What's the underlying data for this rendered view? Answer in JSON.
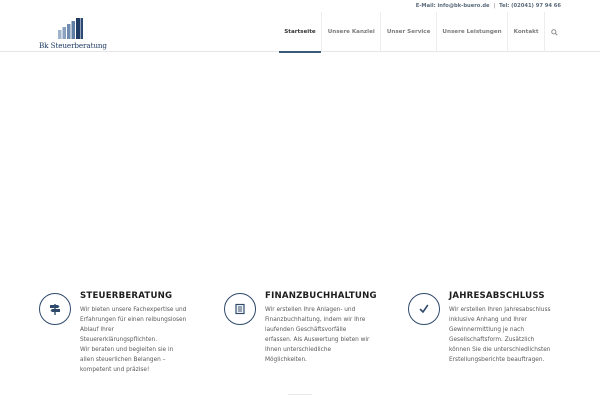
{
  "topbar": {
    "email": "E-Mail: info@bk-buero.de",
    "separator": "|",
    "phone": "Tel: (02041) 97 94 66"
  },
  "logo": {
    "text": "Bk Steuerberatung",
    "colors": {
      "light": "#9fb4cc",
      "mid": "#5f7ea3",
      "dark": "#1f3a63"
    }
  },
  "nav": {
    "items": [
      {
        "label": "Startseite",
        "active": true
      },
      {
        "label": "Unsere Kanzlei",
        "active": false
      },
      {
        "label": "Unser Service",
        "active": false
      },
      {
        "label": "Unsere Leistungen",
        "active": false
      },
      {
        "label": "Kontakt",
        "active": false
      }
    ],
    "search_icon": "search-icon",
    "accent_color": "#3a5a7c"
  },
  "features": [
    {
      "icon": "signpost-icon",
      "title": "STEUERBERATUNG",
      "text_lines": [
        "Wir bieten unsere Fachexpertise und",
        "Erfahrungen für einen reibungslosen",
        "Ablauf Ihrer",
        "Steuererklärungspflichten.",
        "Wir beraten und begleiten sie in",
        "allen steuerlichen Belangen –",
        "kompetent und präzise!"
      ]
    },
    {
      "icon": "document-icon",
      "title": "FINANZBUCHHALTUNG",
      "text_lines": [
        "Wir erstellen Ihre Anlagen- und",
        "Finanzbuchhaltung, indem wir Ihre",
        "laufenden Geschäftsvorfälle",
        "erfassen. Als Auswertung bieten wir",
        "Ihnen unterschiedliche",
        "Möglichkeiten."
      ]
    },
    {
      "icon": "checkmark-icon",
      "title": "JAHRESABSCHLUSS",
      "text_lines": [
        "Wir erstellen Ihren Jahresabschluss",
        "inklusive Anhang und Ihrer",
        "Gewinnermittlung je nach",
        "Gesellschaftsform. Zusätzlich",
        "können Sie die unterschiedlichsten",
        "Erstellungsberichte beauftragen."
      ]
    }
  ]
}
